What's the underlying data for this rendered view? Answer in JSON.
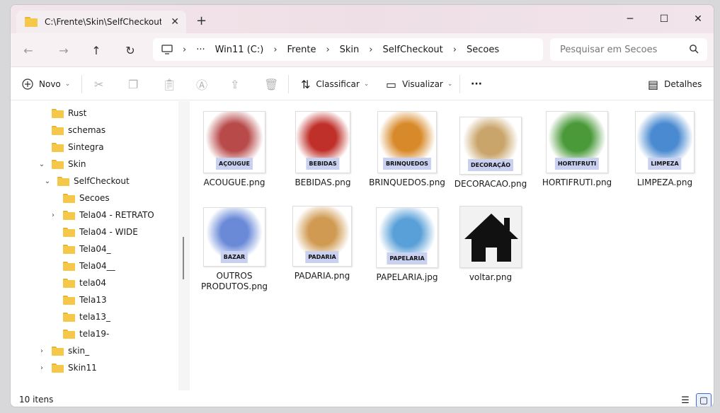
{
  "tab": {
    "title": "C:\\Frente\\Skin\\SelfCheckout\\S",
    "close": "✕",
    "new_tab": "+"
  },
  "window_controls": {
    "minimize": "─",
    "maximize": "☐",
    "close": "✕"
  },
  "nav": {
    "back": "←",
    "forward": "→",
    "up": "↑",
    "refresh": "↻"
  },
  "address": {
    "more": "···",
    "crumbs": [
      "Win11 (C:)",
      "Frente",
      "Skin",
      "SelfCheckout",
      "Secoes"
    ],
    "sep": "›"
  },
  "search": {
    "placeholder": "Pesquisar em Secoes"
  },
  "toolbar": {
    "new_label": "Novo",
    "sort_label": "Classificar",
    "view_label": "Visualizar",
    "more": "···",
    "details_label": "Detalhes"
  },
  "tree": [
    {
      "label": "Rust",
      "chev": "",
      "indent": 0
    },
    {
      "label": "schemas",
      "chev": "",
      "indent": 0
    },
    {
      "label": "Sintegra",
      "chev": "",
      "indent": 0
    },
    {
      "label": "Skin",
      "chev": "⌄",
      "indent": 0
    },
    {
      "label": "SelfCheckout",
      "chev": "⌄",
      "indent": 1
    },
    {
      "label": "Secoes",
      "chev": "",
      "indent": 2
    },
    {
      "label": "Tela04 - RETRATO",
      "chev": "›",
      "indent": 2
    },
    {
      "label": "Tela04 - WIDE",
      "chev": "",
      "indent": 2
    },
    {
      "label": "Tela04_",
      "chev": "",
      "indent": 2
    },
    {
      "label": "Tela04__",
      "chev": "",
      "indent": 2
    },
    {
      "label": "tela04",
      "chev": "",
      "indent": 2
    },
    {
      "label": "Tela13",
      "chev": "",
      "indent": 2
    },
    {
      "label": "tela13_",
      "chev": "",
      "indent": 2
    },
    {
      "label": "tela19-",
      "chev": "",
      "indent": 2
    },
    {
      "label": "skin_",
      "chev": "›",
      "indent": 0
    },
    {
      "label": "Skin11",
      "chev": "›",
      "indent": 0
    }
  ],
  "files": [
    {
      "name": "ACOUGUE.png",
      "tag": "AÇOUGUE",
      "bg": "#b84a4a"
    },
    {
      "name": "BEBIDAS.png",
      "tag": "BEBIDAS",
      "bg": "#c0302a"
    },
    {
      "name": "BRINQUEDOS.png",
      "tag": "BRINQUEDOS",
      "bg": "#d88a2a"
    },
    {
      "name": "DECORACAO.png",
      "tag": "DECORAÇÃO",
      "bg": "#c9a56b"
    },
    {
      "name": "HORTIFRUTI.png",
      "tag": "HORTIFRUTI",
      "bg": "#4a9a3a"
    },
    {
      "name": "LIMPEZA.png",
      "tag": "LIMPEZA",
      "bg": "#4a8ad0"
    },
    {
      "name": "OUTROS PRODUTOS.png",
      "tag": "BAZAR",
      "bg": "#6a8ad8"
    },
    {
      "name": "PADARIA.png",
      "tag": "PADARIA",
      "bg": "#d09a52"
    },
    {
      "name": "PAPELARIA.jpg",
      "tag": "PAPELARIA",
      "bg": "#5aa0d8"
    },
    {
      "name": "voltar.png",
      "tag": "",
      "bg": "#111111"
    }
  ],
  "status": {
    "count": "10 itens"
  }
}
